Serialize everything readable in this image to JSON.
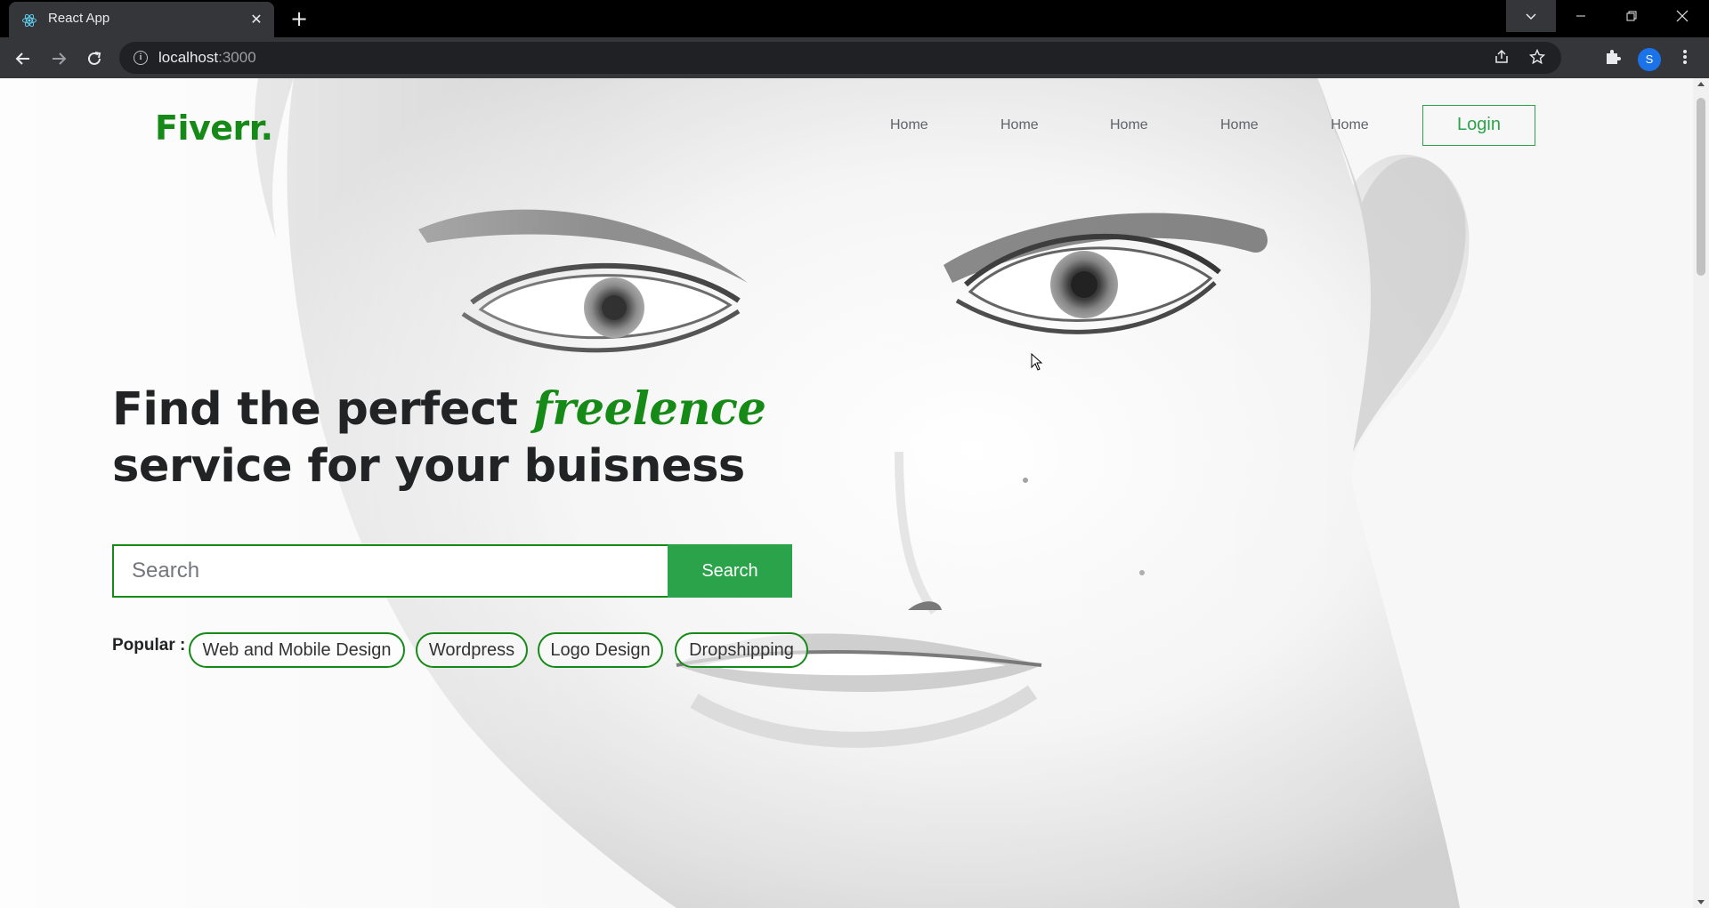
{
  "browser": {
    "tab_title": "React App",
    "tab_close": "✕",
    "new_tab": "+",
    "url_host": "localhost",
    "url_port": ":3000",
    "avatar_letter": "S",
    "icons": [
      "react-favicon-icon",
      "close-icon",
      "plus-icon",
      "chevron-down-icon",
      "minimize-icon",
      "restore-icon",
      "close-window-icon",
      "back-arrow-icon",
      "forward-arrow-icon",
      "reload-icon",
      "info-icon",
      "share-icon",
      "star-icon",
      "puzzle-icon",
      "kebab-menu-icon"
    ]
  },
  "nav": {
    "logo": "Fiverr.",
    "links": [
      "Home",
      "Home",
      "Home",
      "Home",
      "Home"
    ],
    "login": "Login"
  },
  "hero": {
    "headline_part1": "Find the perfect ",
    "headline_accent": "freelence",
    "headline_part2": "service for your buisness",
    "search_placeholder": "Search",
    "search_button": "Search",
    "popular_label": "Popular :",
    "popular_tags": [
      "Web and Mobile Design",
      "Wordpress",
      "Logo Design",
      "Dropshipping"
    ]
  },
  "colors": {
    "brand_green": "#168a16",
    "button_green": "#2aa34a",
    "headline": "#222325"
  }
}
